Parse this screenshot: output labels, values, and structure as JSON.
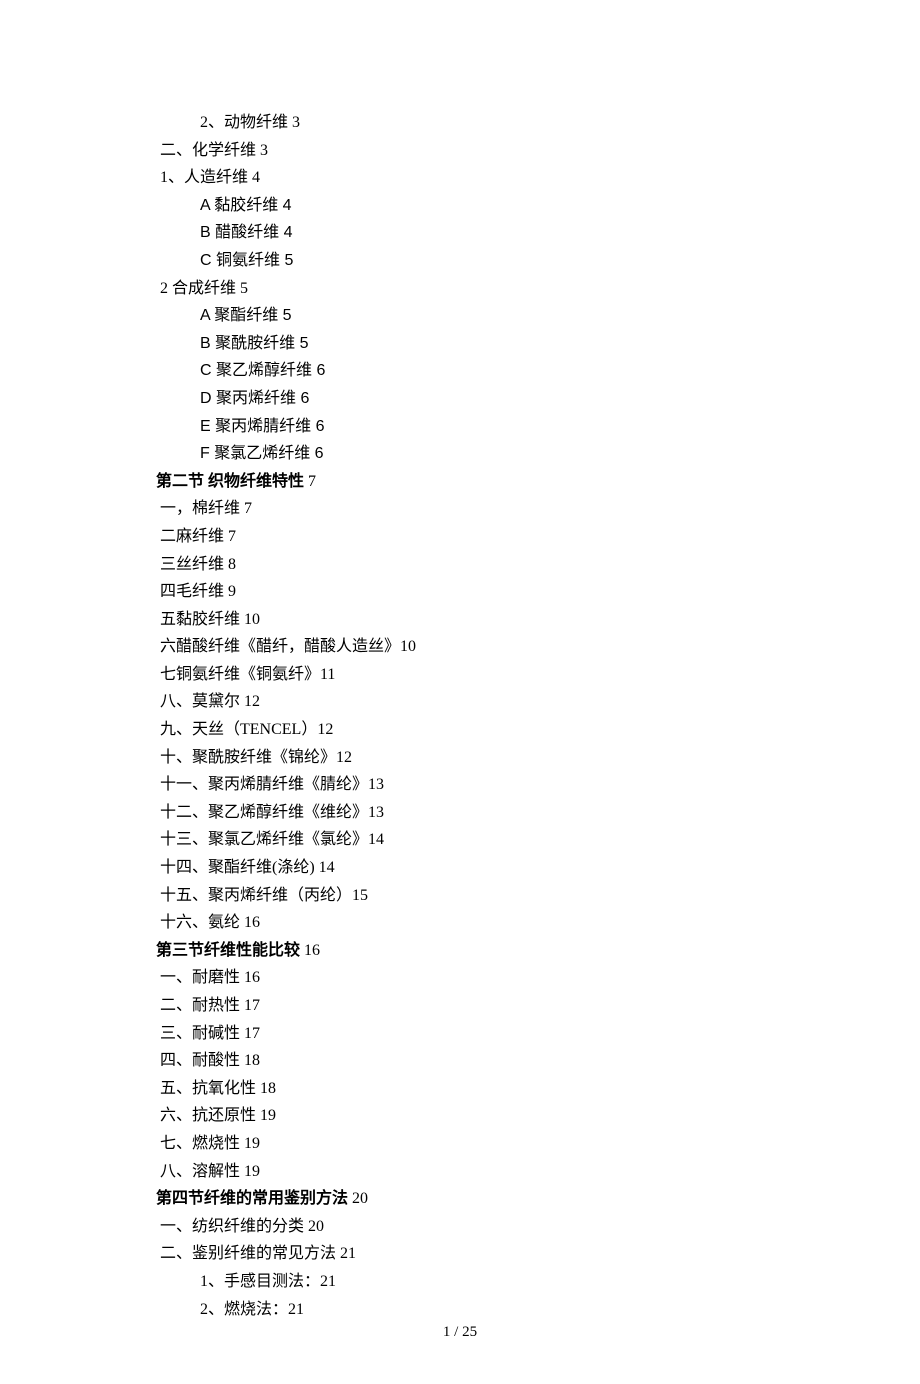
{
  "pre_items": [
    {
      "text": "2、动物纤维 3",
      "indent": 1
    },
    {
      "text": "二、化学纤维 3",
      "indent": 0
    },
    {
      "text": "1、人造纤维 4",
      "indent": 0
    },
    {
      "text": "A 黏胶纤维 4",
      "indent": 1,
      "letter": true
    },
    {
      "text": "B 醋酸纤维 4",
      "indent": 1,
      "letter": true
    },
    {
      "text": "C 铜氨纤维 5",
      "indent": 1,
      "letter": true
    },
    {
      "text": "2 合成纤维 5",
      "indent": 0
    },
    {
      "text": "A 聚酯纤维 5",
      "indent": 1,
      "letter": true
    },
    {
      "text": "B 聚酰胺纤维 5",
      "indent": 1,
      "letter": true
    },
    {
      "text": "C 聚乙烯醇纤维 6",
      "indent": 1,
      "letter": true
    },
    {
      "text": "D 聚丙烯纤维 6",
      "indent": 1,
      "letter": true
    },
    {
      "text": "E 聚丙烯腈纤维 6",
      "indent": 1,
      "letter": true
    },
    {
      "text": "F 聚氯乙烯纤维 6",
      "indent": 1,
      "letter": true
    }
  ],
  "section2": {
    "heading": "第二节  织物纤维特性",
    "pagenum": " 7",
    "items": [
      {
        "text": "一，棉纤维 7"
      },
      {
        "text": "二麻纤维 7"
      },
      {
        "text": "三丝纤维 8"
      },
      {
        "text": "四毛纤维 9"
      },
      {
        "text": "五黏胶纤维 10"
      },
      {
        "text": "六醋酸纤维《醋纤，醋酸人造丝》10"
      },
      {
        "text": "七铜氨纤维《铜氨纤》11"
      },
      {
        "text": "八、莫黛尔 12"
      },
      {
        "text": "九、天丝（TENCEL）12"
      },
      {
        "text": "十、聚酰胺纤维《锦纶》12"
      },
      {
        "text": "十一、聚丙烯腈纤维《腈纶》13"
      },
      {
        "text": "十二、聚乙烯醇纤维《维纶》13"
      },
      {
        "text": "十三、聚氯乙烯纤维《氯纶》14"
      },
      {
        "text": "十四、聚酯纤维(涤纶) 14"
      },
      {
        "text": "十五、聚丙烯纤维（丙纶）15"
      },
      {
        "text": "十六、氨纶 16"
      }
    ]
  },
  "section3": {
    "heading": "第三节纤维性能比较",
    "pagenum": " 16",
    "items": [
      {
        "text": "一、耐磨性 16"
      },
      {
        "text": "二、耐热性 17"
      },
      {
        "text": "三、耐碱性 17"
      },
      {
        "text": "四、耐酸性 18"
      },
      {
        "text": "五、抗氧化性 18"
      },
      {
        "text": "六、抗还原性 19"
      },
      {
        "text": "七、燃烧性 19"
      },
      {
        "text": "八、溶解性 19"
      }
    ]
  },
  "section4": {
    "heading": "第四节纤维的常用鉴别方法",
    "pagenum": " 20",
    "items": [
      {
        "text": "一、纺织纤维的分类 20",
        "indent": 0
      },
      {
        "text": "二、鉴别纤维的常见方法 21",
        "indent": 0
      },
      {
        "text": "1、手感目测法：21",
        "indent": 1
      },
      {
        "text": "2、燃烧法：21",
        "indent": 1
      }
    ]
  },
  "footer": "1 / 25"
}
